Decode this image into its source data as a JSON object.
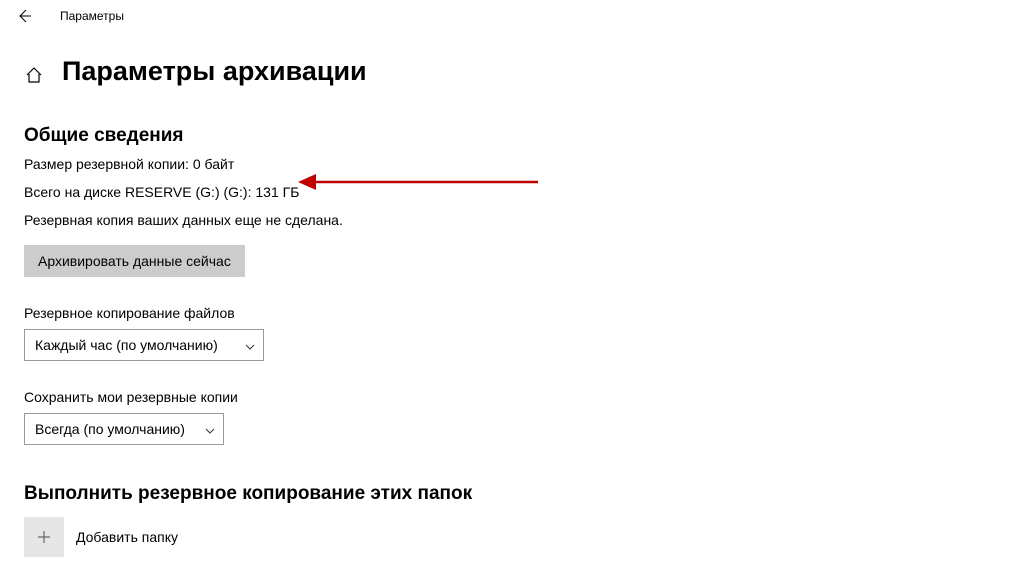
{
  "titlebar": {
    "title": "Параметры"
  },
  "page": {
    "title": "Параметры архивации"
  },
  "overview": {
    "heading": "Общие сведения",
    "size_label": "Размер резервной копии: 0 байт",
    "disk_label": "Всего на диске RESERVE (G:) (G:): 131 ГБ",
    "status": "Резервная копия ваших данных еще не сделана.",
    "backup_now": "Архивировать данные сейчас"
  },
  "schedule": {
    "label": "Резервное копирование файлов",
    "value": "Каждый час (по умолчанию)"
  },
  "retention": {
    "label": "Сохранить мои резервные копии",
    "value": "Всегда (по умолчанию)"
  },
  "folders": {
    "heading": "Выполнить резервное копирование этих папок",
    "add_label": "Добавить папку"
  }
}
